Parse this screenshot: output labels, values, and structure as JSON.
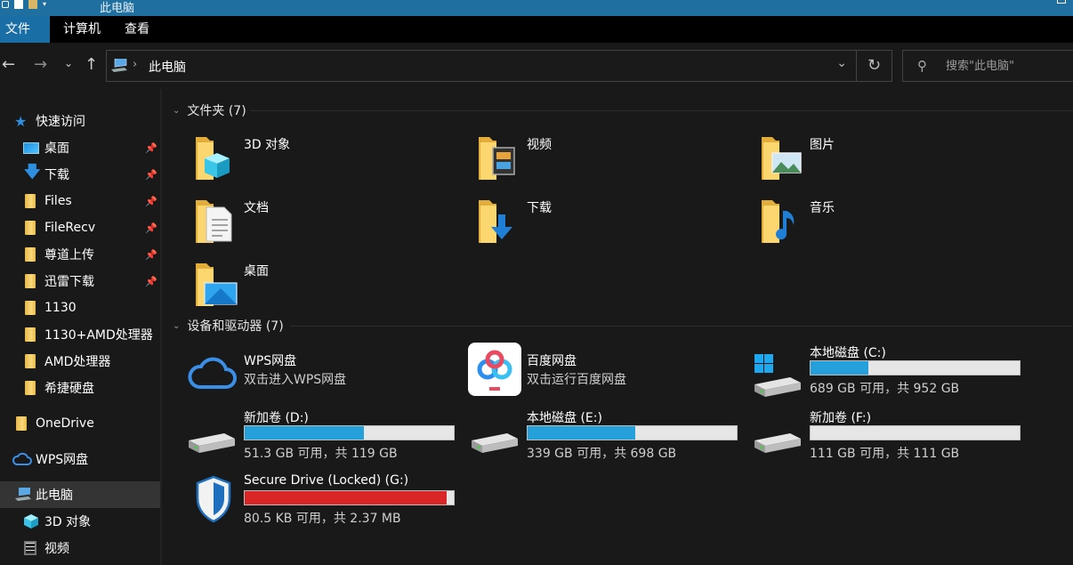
{
  "window": {
    "title": "此电脑"
  },
  "ribbon": {
    "tabs": [
      "文件",
      "计算机",
      "查看"
    ]
  },
  "address": {
    "path": "此电脑",
    "search_placeholder": "搜索\"此电脑\""
  },
  "sidebar": {
    "items": [
      {
        "label": "快速访问",
        "icon": "star-icon",
        "pinned": false
      },
      {
        "label": "桌面",
        "icon": "desktop-icon",
        "pinned": true
      },
      {
        "label": "下载",
        "icon": "download-icon",
        "pinned": true
      },
      {
        "label": "Files",
        "icon": "folder-icon",
        "pinned": true
      },
      {
        "label": "FileRecv",
        "icon": "folder-icon",
        "pinned": true
      },
      {
        "label": "尊道上传",
        "icon": "folder-icon",
        "pinned": true
      },
      {
        "label": "迅雷下载",
        "icon": "folder-icon",
        "pinned": true
      },
      {
        "label": "1130",
        "icon": "folder-icon",
        "pinned": false
      },
      {
        "label": "1130+AMD处理器",
        "icon": "folder-icon",
        "pinned": false
      },
      {
        "label": "AMD处理器",
        "icon": "folder-icon",
        "pinned": false
      },
      {
        "label": "希捷硬盘",
        "icon": "folder-icon",
        "pinned": false
      },
      {
        "label": "OneDrive",
        "icon": "folder-icon",
        "pinned": false
      },
      {
        "label": "WPS网盘",
        "icon": "cloud-icon",
        "pinned": false
      },
      {
        "label": "此电脑",
        "icon": "computer-icon",
        "pinned": false
      },
      {
        "label": "3D 对象",
        "icon": "cube-icon",
        "pinned": false
      },
      {
        "label": "视频",
        "icon": "video-icon",
        "pinned": false
      }
    ]
  },
  "folders": {
    "header": "文件夹 (7)",
    "items": [
      {
        "name": "3D 对象",
        "icon": "3d-objects-folder-icon"
      },
      {
        "name": "视频",
        "icon": "videos-folder-icon"
      },
      {
        "name": "图片",
        "icon": "pictures-folder-icon"
      },
      {
        "name": "文档",
        "icon": "documents-folder-icon"
      },
      {
        "name": "下载",
        "icon": "downloads-folder-icon"
      },
      {
        "name": "音乐",
        "icon": "music-folder-icon"
      },
      {
        "name": "桌面",
        "icon": "desktop-folder-icon"
      }
    ]
  },
  "devices": {
    "header": "设备和驱动器 (7)",
    "apps": [
      {
        "name": "WPS网盘",
        "sub": "双击进入WPS网盘",
        "icon": "wps-cloud-icon"
      },
      {
        "name": "百度网盘",
        "sub": "双击运行百度网盘",
        "icon": "baidu-netdisk-icon"
      }
    ],
    "drives": [
      {
        "name": "本地磁盘 (C:)",
        "sub": "689 GB 可用，共 952 GB",
        "used_fraction": 0.276,
        "icon": "windows-drive-icon"
      },
      {
        "name": "新加卷 (D:)",
        "sub": "51.3 GB 可用，共 119 GB",
        "used_fraction": 0.569,
        "icon": "hard-drive-icon"
      },
      {
        "name": "本地磁盘 (E:)",
        "sub": "339 GB 可用，共 698 GB",
        "used_fraction": 0.514,
        "icon": "hard-drive-icon"
      },
      {
        "name": "新加卷 (F:)",
        "sub": "111 GB 可用，共 111 GB",
        "used_fraction": 0.0,
        "icon": "hard-drive-icon"
      },
      {
        "name": "Secure Drive (Locked) (G:)",
        "sub": "80.5 KB 可用，共 2.37 MB",
        "used_fraction": 0.967,
        "icon": "shield-drive-icon"
      }
    ]
  },
  "colors": {
    "accent": "#1a6ea6",
    "bar_fill": "#26a0da",
    "bar_full": "#da2626"
  }
}
